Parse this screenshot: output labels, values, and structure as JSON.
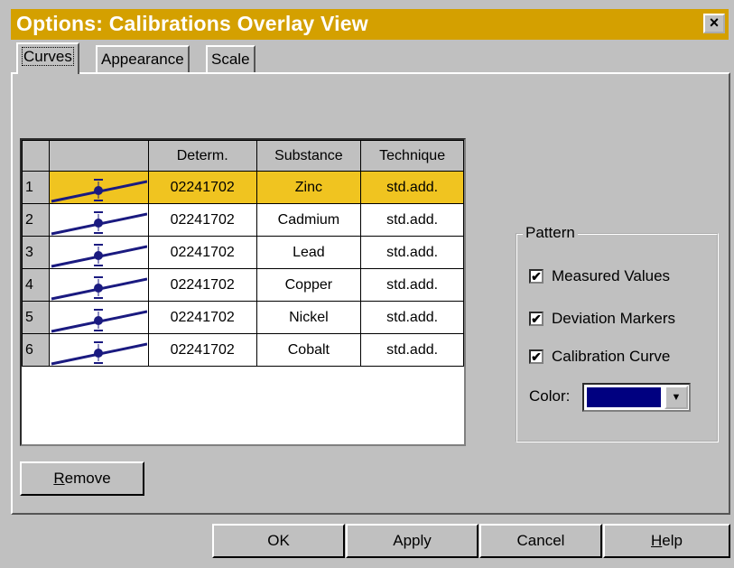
{
  "window": {
    "title": "Options: Calibrations Overlay View",
    "close_glyph": "×"
  },
  "tabs": [
    {
      "label": "Curves",
      "active": true
    },
    {
      "label": "Appearance",
      "active": false
    },
    {
      "label": "Scale",
      "active": false
    }
  ],
  "table": {
    "columns": [
      "Determ.",
      "Substance",
      "Technique"
    ],
    "rows": [
      {
        "num": "1",
        "determ": "02241702",
        "substance": "Zinc",
        "technique": "std.add.",
        "selected": true
      },
      {
        "num": "2",
        "determ": "02241702",
        "substance": "Cadmium",
        "technique": "std.add."
      },
      {
        "num": "3",
        "determ": "02241702",
        "substance": "Lead",
        "technique": "std.add."
      },
      {
        "num": "4",
        "determ": "02241702",
        "substance": "Copper",
        "technique": "std.add."
      },
      {
        "num": "5",
        "determ": "02241702",
        "substance": "Nickel",
        "technique": "std.add."
      },
      {
        "num": "6",
        "determ": "02241702",
        "substance": "Cobalt",
        "technique": "std.add."
      }
    ]
  },
  "remove_button": {
    "mnemonic": "R",
    "rest": "emove"
  },
  "pattern": {
    "title": "Pattern",
    "measured_values": {
      "label": "Measured Values",
      "checked": true
    },
    "deviation_markers": {
      "label": "Deviation Markers",
      "checked": true
    },
    "calibration_curve": {
      "label": "Calibration Curve",
      "checked": true
    },
    "color_label": "Color:",
    "color_value": "#000080"
  },
  "buttons": {
    "ok": "OK",
    "apply": "Apply",
    "cancel": "Cancel",
    "help_mnemonic": "H",
    "help_rest": "elp"
  },
  "icons": {
    "check": "✔",
    "dropdown": "▼"
  },
  "colors": {
    "title_bar": "#d4a000",
    "selection": "#f0c420",
    "curve_icon": "#1a1a80"
  }
}
